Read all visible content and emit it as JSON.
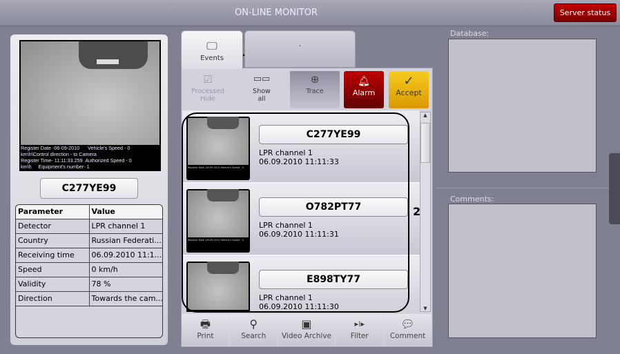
{
  "window": {
    "title": "ON-LINE MONITOR",
    "server_status": "Server status"
  },
  "snapshot": {
    "overlay_lines": [
      "Register Date -06-09-2010      Vehicle's Speed - 0",
      "km\\h\\Control direction - to Camera",
      "Register Time- 11:11:33.259  Authorized Speed - 0",
      "km\\h     Equipment's number- 1"
    ]
  },
  "current": {
    "plate": "C277YE99",
    "table": {
      "headers": [
        "Parameter",
        "Value"
      ],
      "rows": [
        [
          "Detector",
          "LPR channel 1"
        ],
        [
          "Country",
          "Russian Federati..."
        ],
        [
          "Receiving time",
          "06.09.2010 11:1..."
        ],
        [
          "Speed",
          "0 km/h"
        ],
        [
          "Validity",
          "78 %"
        ],
        [
          "Direction",
          "Towards the cam..."
        ]
      ]
    }
  },
  "tabs": [
    {
      "label": "Events",
      "icon": "monitor-icon"
    },
    {
      "label": "."
    }
  ],
  "toolbar": {
    "processed_hide": "Processed\nHide",
    "show_all": "Show\nall",
    "trace": "Trace",
    "alarm": "Alarm",
    "accept": "Accept"
  },
  "events": [
    {
      "plate": "C277YE99",
      "detector": "LPR channel 1",
      "time": "06.09.2010 11:11:33"
    },
    {
      "plate": "O782PT77",
      "detector": "LPR channel 1",
      "time": "06.09.2010 11:11:31"
    },
    {
      "plate": "E898TY77",
      "detector": "LPR channel 1",
      "time": "06.09.2010 11:11:30"
    }
  ],
  "bottom_toolbar": [
    {
      "label": "Print",
      "icon": "printer-icon"
    },
    {
      "label": "Search",
      "icon": "magnifier-icon"
    },
    {
      "label": "Video Archive",
      "icon": "video-archive-icon"
    },
    {
      "label": "Filter",
      "icon": "filter-icon"
    },
    {
      "label": "Comment",
      "icon": "comment-icon"
    }
  ],
  "right": {
    "database_label": "Database:",
    "comments_label": "Comments:"
  },
  "annotations": {
    "one": "1",
    "two": "2"
  },
  "colors": {
    "alarm": "#a00000",
    "accept": "#f0b000",
    "server_status": "#b00000"
  }
}
